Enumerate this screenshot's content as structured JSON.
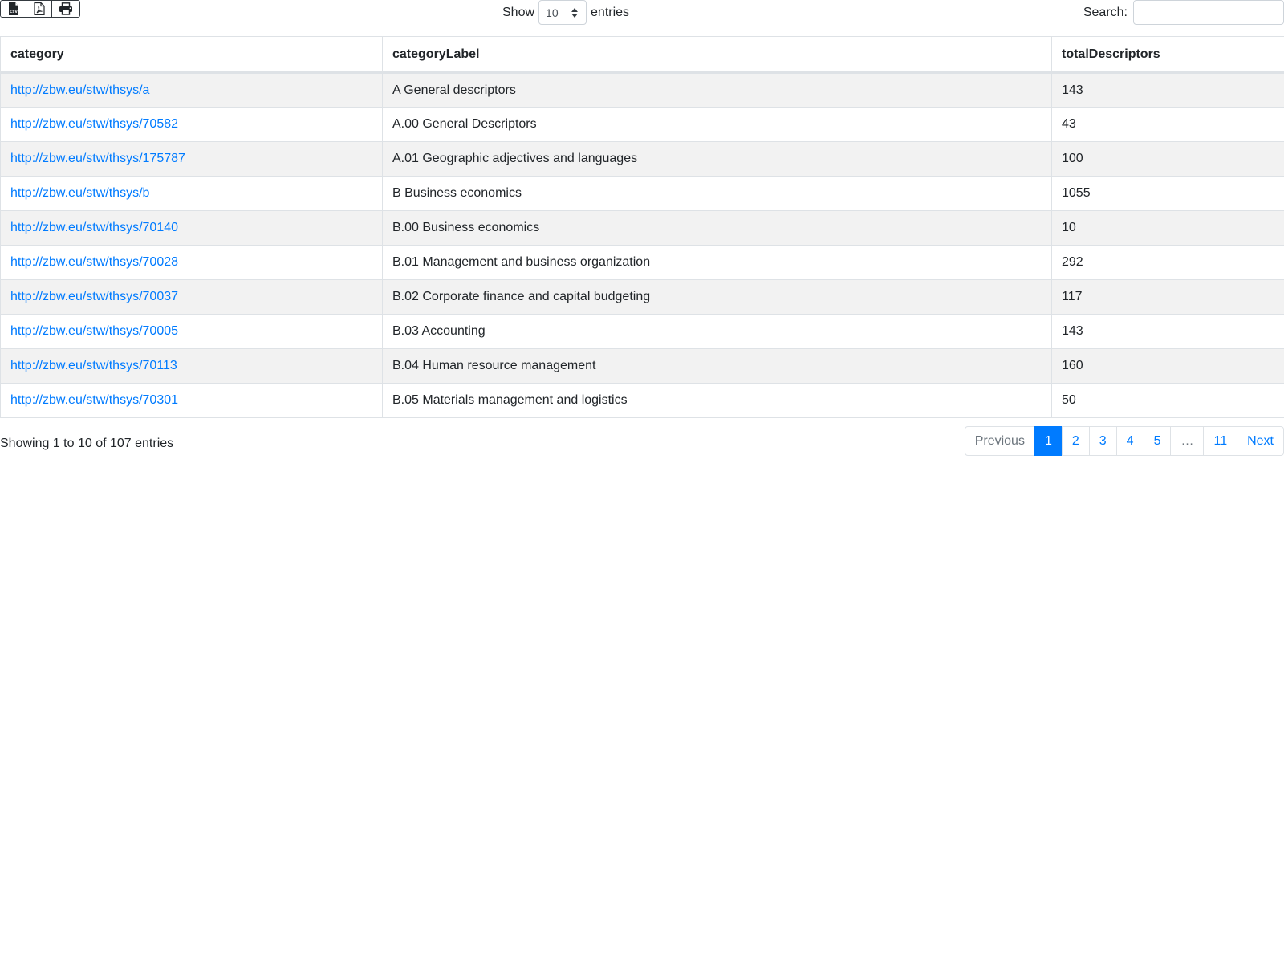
{
  "toolbar": {
    "export_buttons": [
      {
        "icon": "csv-file-icon",
        "name": "export-csv-button"
      },
      {
        "icon": "pdf-file-icon",
        "name": "export-pdf-button"
      },
      {
        "icon": "print-icon",
        "name": "print-button"
      }
    ]
  },
  "length": {
    "prefix": "Show",
    "selected": "10",
    "suffix": "entries"
  },
  "search": {
    "label": "Search:",
    "value": "",
    "placeholder": ""
  },
  "table": {
    "columns": [
      "category",
      "categoryLabel",
      "totalDescriptors"
    ],
    "rows": [
      {
        "category": "http://zbw.eu/stw/thsys/a",
        "label": "A General descriptors",
        "total": "143"
      },
      {
        "category": "http://zbw.eu/stw/thsys/70582",
        "label": "A.00 General Descriptors",
        "total": "43"
      },
      {
        "category": "http://zbw.eu/stw/thsys/175787",
        "label": "A.01 Geographic adjectives and languages",
        "total": "100"
      },
      {
        "category": "http://zbw.eu/stw/thsys/b",
        "label": "B Business economics",
        "total": "1055"
      },
      {
        "category": "http://zbw.eu/stw/thsys/70140",
        "label": "B.00 Business economics",
        "total": "10"
      },
      {
        "category": "http://zbw.eu/stw/thsys/70028",
        "label": "B.01 Management and business organization",
        "total": "292"
      },
      {
        "category": "http://zbw.eu/stw/thsys/70037",
        "label": "B.02 Corporate finance and capital budgeting",
        "total": "117"
      },
      {
        "category": "http://zbw.eu/stw/thsys/70005",
        "label": "B.03 Accounting",
        "total": "143"
      },
      {
        "category": "http://zbw.eu/stw/thsys/70113",
        "label": "B.04 Human resource management",
        "total": "160"
      },
      {
        "category": "http://zbw.eu/stw/thsys/70301",
        "label": "B.05 Materials management and logistics",
        "total": "50"
      }
    ]
  },
  "info": "Showing 1 to 10 of 107 entries",
  "pagination": {
    "previous": "Previous",
    "pages": [
      "1",
      "2",
      "3",
      "4",
      "5",
      "…",
      "11"
    ],
    "active": "1",
    "next": "Next"
  },
  "colors": {
    "link": "#007bff",
    "active_page": "#007bff",
    "stripe": "#f2f2f2",
    "border": "#dee2e6"
  }
}
